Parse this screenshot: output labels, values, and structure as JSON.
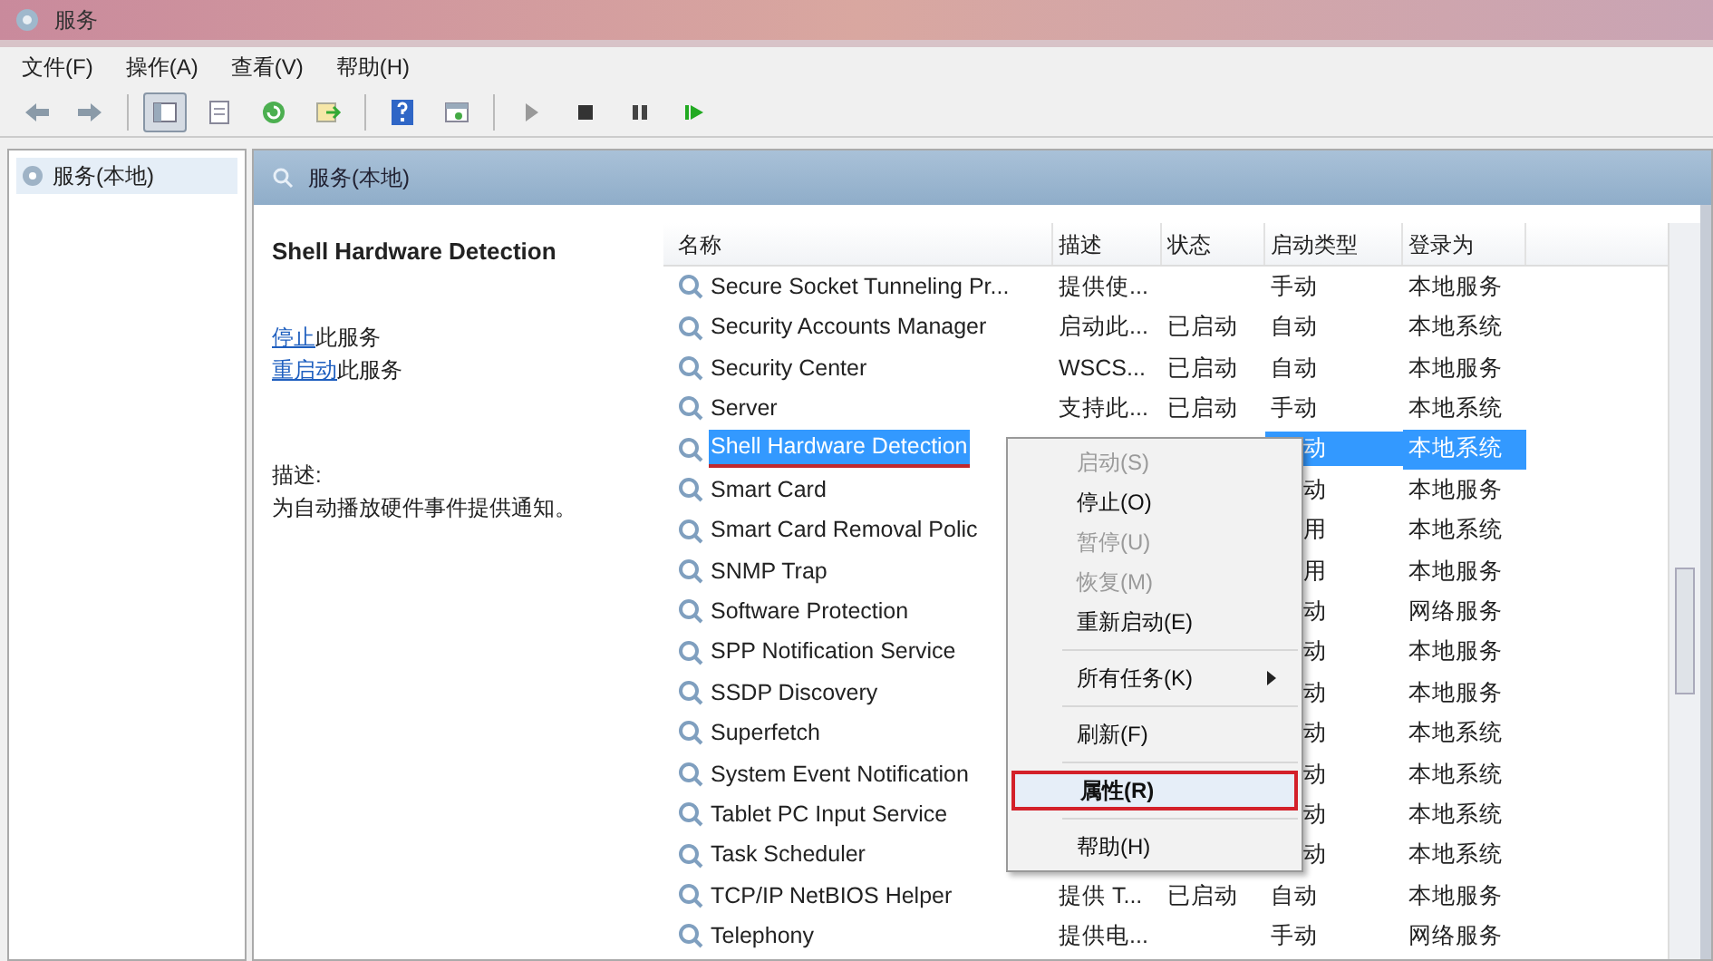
{
  "window": {
    "title": "服务"
  },
  "menu": [
    "文件(F)",
    "操作(A)",
    "查看(V)",
    "帮助(H)"
  ],
  "toolbar": [
    {
      "kind": "back",
      "pressed": false
    },
    {
      "kind": "forward",
      "pressed": false
    },
    {
      "kind": "sep"
    },
    {
      "kind": "tree",
      "pressed": true
    },
    {
      "kind": "props",
      "pressed": false
    },
    {
      "kind": "refresh",
      "pressed": false
    },
    {
      "kind": "export",
      "pressed": false
    },
    {
      "kind": "sep"
    },
    {
      "kind": "help",
      "pressed": false
    },
    {
      "kind": "view",
      "pressed": false
    },
    {
      "kind": "sep"
    },
    {
      "kind": "play",
      "pressed": false
    },
    {
      "kind": "stop",
      "pressed": false
    },
    {
      "kind": "pause",
      "pressed": false
    },
    {
      "kind": "resume",
      "pressed": false
    }
  ],
  "tree": {
    "items": [
      {
        "label": "服务(本地)",
        "selected": true
      }
    ]
  },
  "panel": {
    "title": "服务(本地)"
  },
  "details": {
    "service_name": "Shell Hardware Detection",
    "actions": [
      {
        "link": "停止",
        "text": "此服务"
      },
      {
        "link": "重启动",
        "text": "此服务"
      }
    ],
    "description_label": "描述:",
    "description": "为自动播放硬件事件提供通知。"
  },
  "table": {
    "columns": [
      "名称",
      "描述",
      "状态",
      "启动类型",
      "登录为"
    ],
    "rows": [
      {
        "name": "Secure Socket Tunneling Pr...",
        "description": "提供使...",
        "status": "",
        "startup": "手动",
        "logon": "本地服务",
        "selected": false
      },
      {
        "name": "Security Accounts Manager",
        "description": "启动此...",
        "status": "已启动",
        "startup": "自动",
        "logon": "本地系统",
        "selected": false
      },
      {
        "name": "Security Center",
        "description": "WSCS...",
        "status": "已启动",
        "startup": "自动",
        "logon": "本地服务",
        "selected": false
      },
      {
        "name": "Server",
        "description": "支持此...",
        "status": "已启动",
        "startup": "手动",
        "logon": "本地系统",
        "selected": false
      },
      {
        "name": "Shell Hardware Detection",
        "startup_visible": "动",
        "logon": "本地系统",
        "selected": true
      },
      {
        "name": "Smart Card",
        "startup_visible": "动",
        "logon": "本地服务",
        "selected": false
      },
      {
        "name": "Smart Card Removal Polic",
        "startup_visible": "用",
        "logon": "本地系统",
        "selected": false
      },
      {
        "name": "SNMP Trap",
        "startup_visible": "用",
        "logon": "本地服务",
        "selected": false
      },
      {
        "name": "Software Protection",
        "startup_visible": "动",
        "logon": "网络服务",
        "selected": false
      },
      {
        "name": "SPP Notification Service",
        "startup_visible": "动",
        "logon": "本地服务",
        "selected": false
      },
      {
        "name": "SSDP Discovery",
        "startup_visible": "动",
        "logon": "本地服务",
        "selected": false
      },
      {
        "name": "Superfetch",
        "startup_visible": "动",
        "logon": "本地系统",
        "selected": false
      },
      {
        "name": "System Event Notification",
        "startup_visible": "动",
        "logon": "本地系统",
        "selected": false
      },
      {
        "name": "Tablet PC Input Service",
        "startup_visible": "动",
        "logon": "本地系统",
        "selected": false
      },
      {
        "name": "Task Scheduler",
        "startup_visible": "动",
        "logon": "本地系统",
        "selected": false
      },
      {
        "name": "TCP/IP NetBIOS Helper",
        "description": "提供 T...",
        "status": "已启动",
        "startup": "自动",
        "logon": "本地服务",
        "selected": false
      },
      {
        "name": "Telephony",
        "description": "提供电...",
        "status": "",
        "startup": "手动",
        "logon": "网络服务",
        "selected": false
      }
    ]
  },
  "context_menu": [
    {
      "kind": "item",
      "label": "启动(S)",
      "disabled": true,
      "highlighted": false
    },
    {
      "kind": "item",
      "label": "停止(O)",
      "disabled": false,
      "highlighted": false
    },
    {
      "kind": "item",
      "label": "暂停(U)",
      "disabled": true,
      "highlighted": false
    },
    {
      "kind": "item",
      "label": "恢复(M)",
      "disabled": true,
      "highlighted": false
    },
    {
      "kind": "item",
      "label": "重新启动(E)",
      "disabled": false,
      "highlighted": false
    },
    {
      "kind": "sep"
    },
    {
      "kind": "submenu",
      "label": "所有任务(K)",
      "disabled": false,
      "highlighted": false
    },
    {
      "kind": "sep"
    },
    {
      "kind": "item",
      "label": "刷新(F)",
      "disabled": false,
      "highlighted": false
    },
    {
      "kind": "sep"
    },
    {
      "kind": "item",
      "label": "属性(R)",
      "disabled": false,
      "highlighted": true
    },
    {
      "kind": "sep"
    },
    {
      "kind": "item",
      "label": "帮助(H)",
      "disabled": false,
      "highlighted": false
    }
  ]
}
